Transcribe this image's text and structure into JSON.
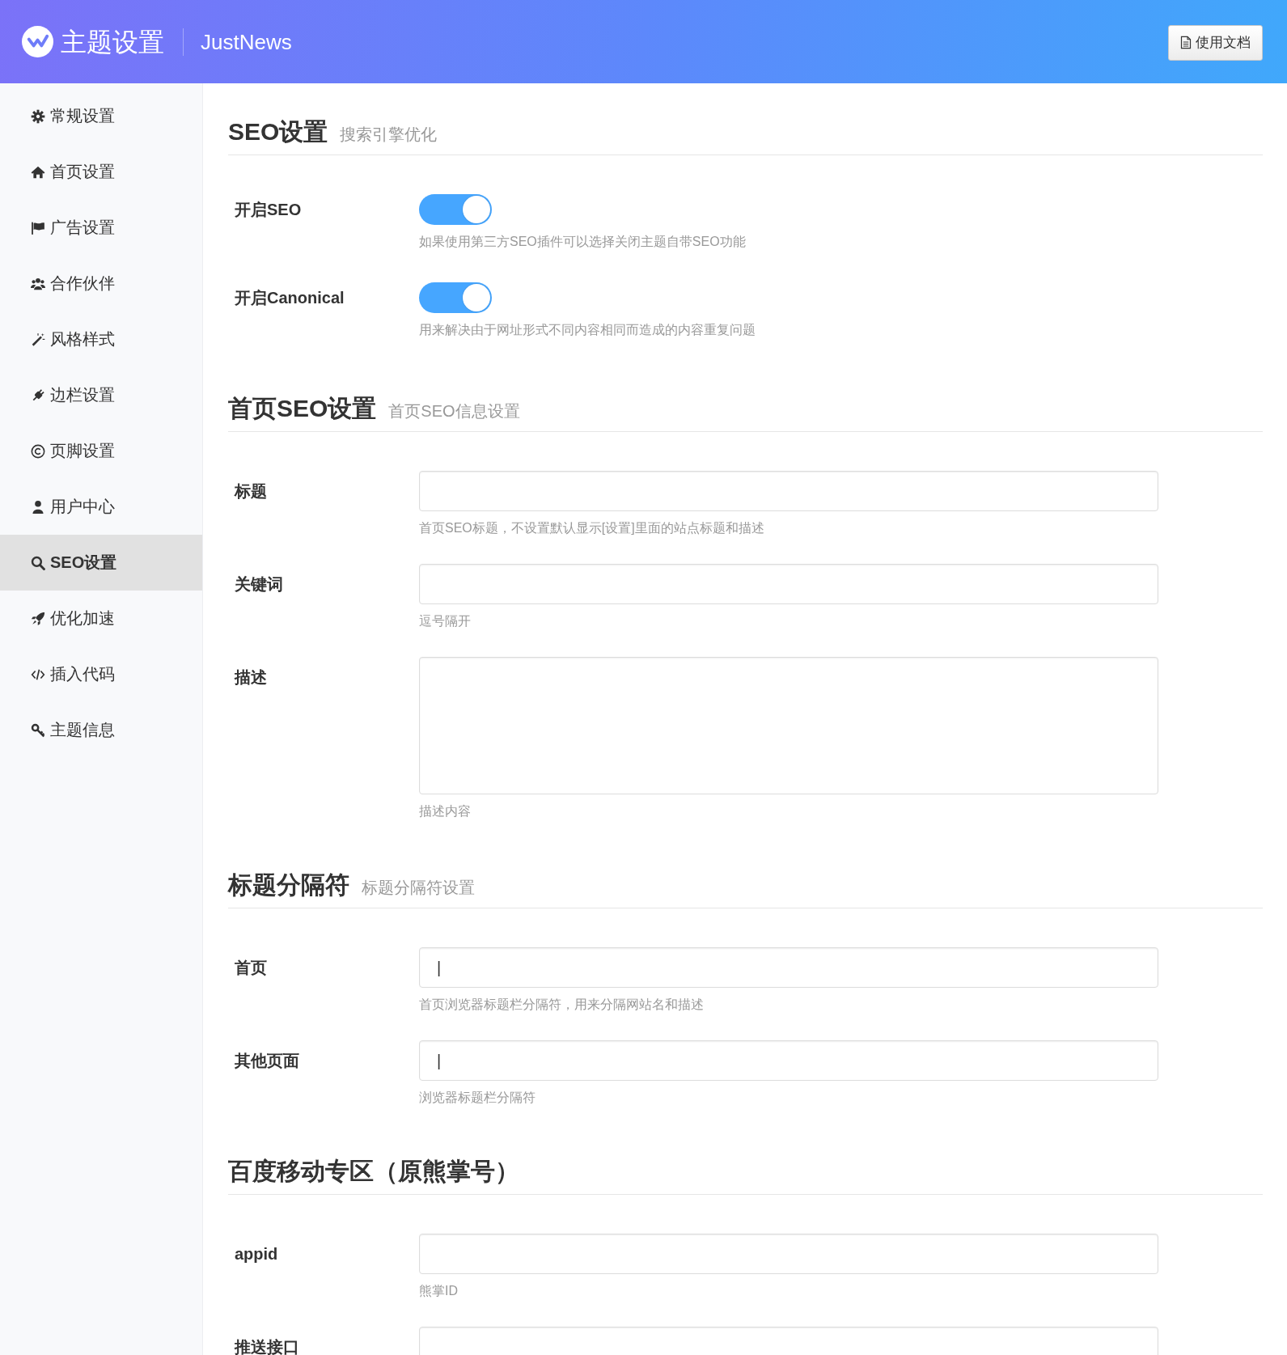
{
  "header": {
    "title": "主题设置",
    "brand": "JustNews",
    "docs_button": "使用文档"
  },
  "sidebar": {
    "items": [
      {
        "label": "常规设置",
        "selected": false
      },
      {
        "label": "首页设置",
        "selected": false
      },
      {
        "label": "广告设置",
        "selected": false
      },
      {
        "label": "合作伙伴",
        "selected": false
      },
      {
        "label": "风格样式",
        "selected": false
      },
      {
        "label": "边栏设置",
        "selected": false
      },
      {
        "label": "页脚设置",
        "selected": false
      },
      {
        "label": "用户中心",
        "selected": false
      },
      {
        "label": "SEO设置",
        "selected": true
      },
      {
        "label": "优化加速",
        "selected": false
      },
      {
        "label": "插入代码",
        "selected": false
      },
      {
        "label": "主题信息",
        "selected": false
      }
    ]
  },
  "sections": [
    {
      "title": "SEO设置",
      "subtitle": "搜索引擎优化",
      "rows": [
        {
          "kind": "toggle",
          "label": "开启SEO",
          "on": true,
          "help": "如果使用第三方SEO插件可以选择关闭主题自带SEO功能"
        },
        {
          "kind": "toggle",
          "label": "开启Canonical",
          "on": true,
          "help": "用来解决由于网址形式不同内容相同而造成的内容重复问题"
        }
      ]
    },
    {
      "title": "首页SEO设置",
      "subtitle": "首页SEO信息设置",
      "rows": [
        {
          "kind": "input",
          "label": "标题",
          "help": "首页SEO标题，不设置默认显示[设置]里面的站点标题和描述"
        },
        {
          "kind": "input",
          "label": "关键词",
          "help": "逗号隔开"
        },
        {
          "kind": "textarea",
          "label": "描述",
          "help": "描述内容"
        }
      ]
    },
    {
      "title": "标题分隔符",
      "subtitle": "标题分隔符设置",
      "rows": [
        {
          "kind": "input",
          "label": "首页",
          "value": "|",
          "help": "首页浏览器标题栏分隔符，用来分隔网站名和描述"
        },
        {
          "kind": "input",
          "label": "其他页面",
          "value": "|",
          "help": "浏览器标题栏分隔符"
        }
      ]
    },
    {
      "title": "百度移动专区（原熊掌号）",
      "rows": [
        {
          "kind": "input",
          "label": "appid",
          "help": "熊掌ID"
        },
        {
          "kind": "input",
          "label": "推送接口"
        }
      ]
    }
  ]
}
